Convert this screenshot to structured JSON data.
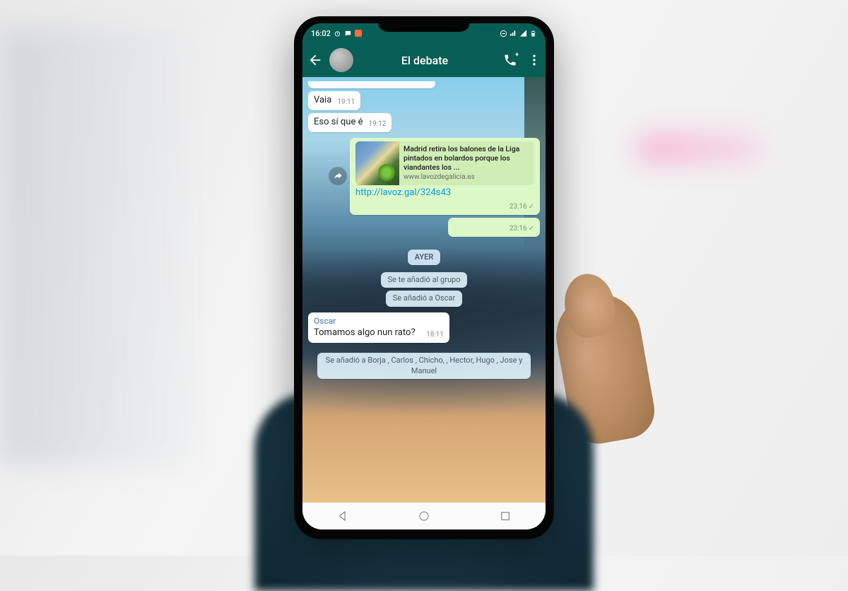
{
  "status": {
    "time": "16:02"
  },
  "header": {
    "title": "El debate"
  },
  "messages": {
    "m1": {
      "text": "Vaia",
      "time": "19:11"
    },
    "m2": {
      "text": "Eso sí que é",
      "time": "19:12"
    },
    "link": {
      "title": "Madrid retira los balones de la Liga pintados en bolardos porque los viandantes los ...",
      "domain": "www.lavozdegalicia.es",
      "url": "http://lavoz.gal/324s43",
      "time": "23:16"
    },
    "m4": {
      "time": "23:16"
    },
    "date1": "AYER",
    "sys1": "Se te añadió al grupo",
    "sys2": "Se añadió a Oscar",
    "m5": {
      "sender": "Oscar",
      "text": "Tomamos algo nun rato?",
      "time": "18:11"
    },
    "sys3": "Se añadió a Borja      , Carlos        , Chicho,          , Hector, Hugo   , Jose y Manuel"
  },
  "icons": {
    "back": "back-arrow-icon",
    "call": "call-icon",
    "more": "more-icon"
  }
}
